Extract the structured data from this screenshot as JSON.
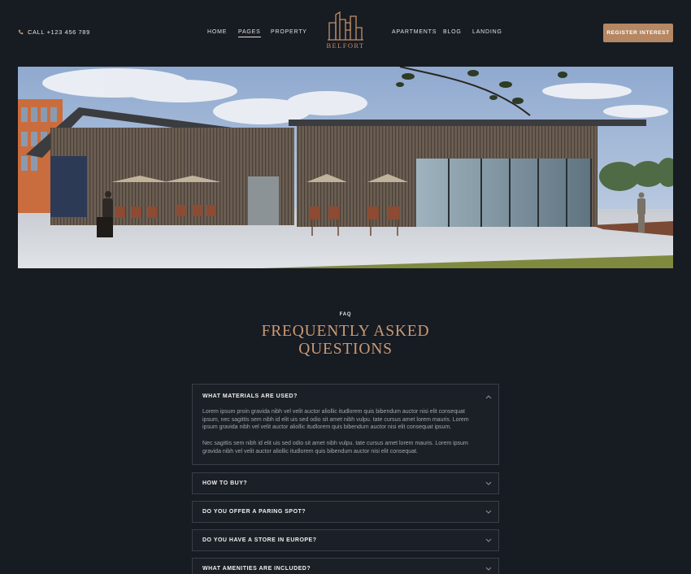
{
  "header": {
    "call_label": "CALL +123 456 789",
    "nav_left": [
      "HOME",
      "PAGES",
      "PROPERTY"
    ],
    "nav_right": [
      "APARTMENTS",
      "BLOG",
      "LANDING"
    ],
    "active_nav": "PAGES",
    "logo_text": "BELFORT",
    "register_label": "REGISTER INTEREST"
  },
  "faq": {
    "eyebrow": "FAQ",
    "title_line1": "FREQUENTLY ASKED",
    "title_line2": "QUESTIONS",
    "items": [
      {
        "question": "WHAT MATERIALS ARE USED?",
        "expanded": true,
        "answer_p1": "Lorem ipsum proin gravida nibh vel velit auctor aliollic itudlorem quis bibendum auctor nisi elit consequat ipsum, nec sagittis sem nibh id elit uis sed odio sit amet nibh vulpu. tate cursus amet lorem mauris. Lorem ipsum gravida nibh vel velit auctor aliollic itudlorem quis bibendum auctor nisi elit consequat ipsum.",
        "answer_p2": "Nec sagittis sem nibh id elit uis sed odio sit amet nibh vulpu. tate cursus amet lorem mauris. Lorem ipsum gravida nibh vel velit auctor aliollic itudlorem quis bibendum auctor nisi elit consequat."
      },
      {
        "question": "HOW TO BUY?",
        "expanded": false
      },
      {
        "question": "DO YOU OFFER A PARING SPOT?",
        "expanded": false
      },
      {
        "question": "DO YOU HAVE A STORE IN EUROPE?",
        "expanded": false
      },
      {
        "question": "WHAT AMENITIES ARE INCLUDED?",
        "expanded": false
      }
    ]
  },
  "colors": {
    "background": "#171b22",
    "accent": "#b58762",
    "title_accent": "#c99a74",
    "border": "#3a3f48"
  },
  "icons": [
    "phone-icon",
    "building-logo-icon",
    "chevron-up-icon",
    "chevron-down-icon"
  ]
}
